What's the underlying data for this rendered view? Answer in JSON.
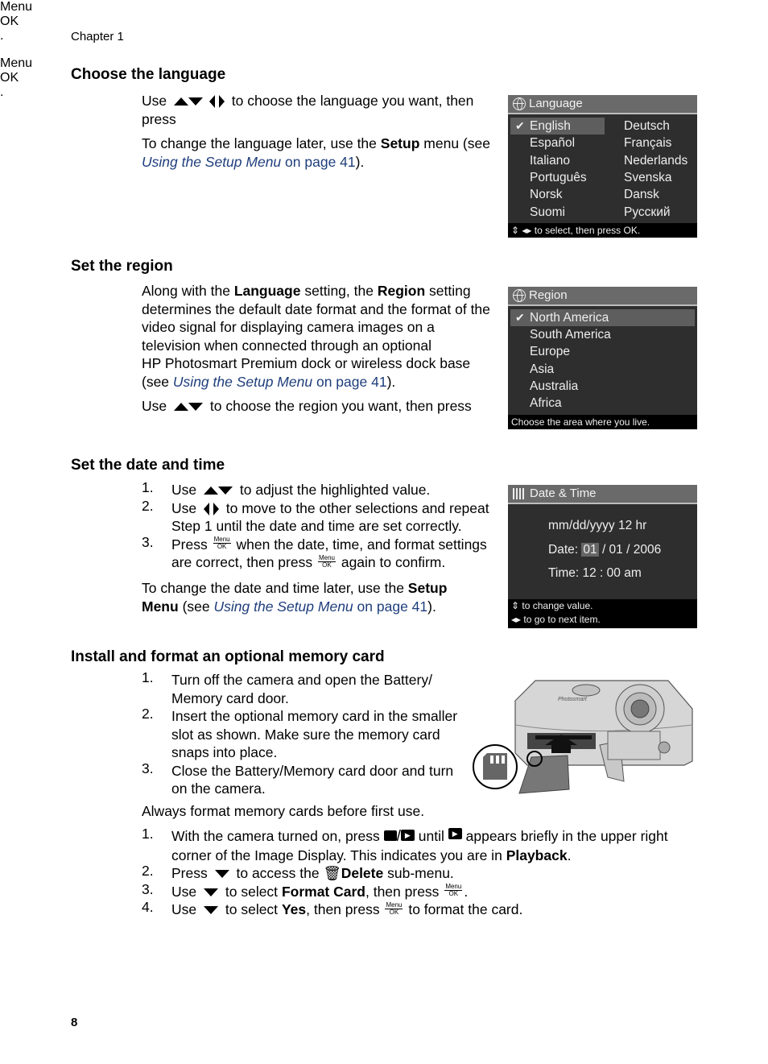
{
  "header": {
    "chapter": "Chapter 1"
  },
  "footer": {
    "page_number": "8"
  },
  "sections": {
    "language": {
      "heading": "Choose the language",
      "p1_use": "Use",
      "p1_rest": "to choose the language you want, then",
      "p1_press": "press",
      "p2_pre": "To change the language later, use the",
      "p2_bold": "Setup",
      "p2_mid": "menu (see",
      "p2_link_italic": "Using the Setup Menu",
      "p2_link_page": "on page 41",
      "p2_end": ")."
    },
    "region": {
      "heading": "Set the region",
      "p1_a": "Along with the",
      "p1_b": "Language",
      "p1_c": "setting, the",
      "p1_d": "Region",
      "p1_e": "setting",
      "p1_line2": "determines the default date format and the format of the",
      "p1_line3": "video signal for displaying camera images on a",
      "p1_line4": "television when connected through an optional",
      "p1_line5": "HP Photosmart Premium dock or wireless dock base",
      "p1_line6_pre": "(see",
      "p1_link_italic": "Using the Setup Menu",
      "p1_link_page": "on page 41",
      "p1_end": ").",
      "p2_use": "Use",
      "p2_rest": "to choose the region you want, then press"
    },
    "datetime": {
      "heading": "Set the date and time",
      "steps": [
        {
          "num": "1.",
          "pre": "Use",
          "post": "to adjust the highlighted value."
        },
        {
          "num": "2.",
          "pre": "Use",
          "post": "to move to the other selections and repeat",
          "line2": "Step 1 until the date and time are set correctly."
        },
        {
          "num": "3.",
          "pre": "Press",
          "post": "when the date, time, and format settings",
          "line2_pre": "are correct, then press",
          "line2_post": "again to confirm."
        }
      ],
      "p_pre": "To change the date and time later, use the",
      "p_bold1": "Setup",
      "p_bold2": "Menu",
      "p_mid": "(see",
      "p_link_italic": "Using the Setup Menu",
      "p_link_page": "on page 41",
      "p_end": ")."
    },
    "memory": {
      "heading": "Install and format an optional memory card",
      "steps": [
        {
          "num": "1.",
          "line1": "Turn off the camera and open the Battery/",
          "line2": "Memory card door."
        },
        {
          "num": "2.",
          "line1": "Insert the optional memory card in the smaller",
          "line2": "slot as shown. Make sure the memory card",
          "line3": "snaps into place."
        },
        {
          "num": "3.",
          "line1": "Close the Battery/Memory card door and turn",
          "line2": "on the camera."
        }
      ],
      "note": "Always format memory cards before first use.",
      "format_steps": [
        {
          "num": "1.",
          "a": "With the camera turned on, press",
          "b": "until",
          "c": "appears briefly in the upper right",
          "line2_pre": "corner of the Image Display. This indicates you are in",
          "line2_bold": "Playback",
          "line2_end": "."
        },
        {
          "num": "2.",
          "a": "Press",
          "b": "to access the",
          "bold": "Delete",
          "c": "sub-menu."
        },
        {
          "num": "3.",
          "a": "Use",
          "b": "to select",
          "bold": "Format Card",
          "c": ", then press",
          "end": "."
        },
        {
          "num": "4.",
          "a": "Use",
          "b": "to select",
          "bold": "Yes",
          "c": ", then press",
          "end": "to format the card."
        }
      ]
    }
  },
  "menu_ok_button": {
    "top": "Menu",
    "bottom": "OK"
  },
  "screens": {
    "language": {
      "title": "Language",
      "items_left": [
        "English",
        "Español",
        "Italiano",
        "Português",
        "Norsk",
        "Suomi"
      ],
      "items_right": [
        "Deutsch",
        "Français",
        "Nederlands",
        "Svenska",
        "Dansk",
        "Русский"
      ],
      "selected": "English",
      "footer": "to select, then press OK."
    },
    "region": {
      "title": "Region",
      "items": [
        "North America",
        "South America",
        "Europe",
        "Asia",
        "Australia",
        "Africa"
      ],
      "selected": "North America",
      "footer": "Choose the area where you live."
    },
    "datetime": {
      "title": "Date & Time",
      "format": "mm/dd/yyyy  12 hr",
      "date_label": "Date:",
      "date_month": "01",
      "date_rest": "/ 01 / 2006",
      "time_label": "Time:",
      "time_value": "12 : 00  am",
      "footer1": "to change value.",
      "footer2": "to go to next item."
    }
  },
  "illustration": {
    "camera_brand_label": "Photosmart"
  }
}
